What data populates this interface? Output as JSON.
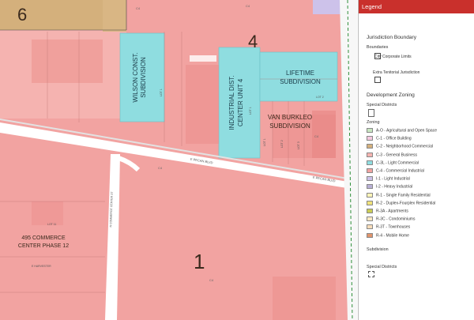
{
  "map": {
    "district_labels": [
      "6",
      "4",
      "1"
    ],
    "subdivisions": [
      "WILSON CONST. SUBDIVISION",
      "INDUSTRIAL DIST. CENTER UNIT 4",
      "LIFETIME SUBDIVISION",
      "VAN BURKLEO SUBDIVISION",
      "495 COMMERCE CENTER PHASE 12"
    ],
    "subdivision_lines": {
      "wilson": [
        "WILSON CONST.",
        "SUBDIVISION"
      ],
      "industrial": [
        "INDUSTRIAL DIST.",
        "CENTER UNIT 4"
      ],
      "lifetime": [
        "LIFETIME",
        "SUBDIVISION"
      ],
      "vanburkleo": [
        "VAN BURKLEO",
        "SUBDIVISION"
      ],
      "commerce": [
        "495 COMMERCE",
        "CENTER PHASE 12"
      ]
    },
    "street_labels": [
      "E PECAN BLVD",
      "E PECAN BLVD",
      "N COMMERCE CENTER ST",
      "E HARVESTER"
    ],
    "lot_labels": [
      "LOT 1",
      "LOT 1",
      "LOT 2",
      "LOT 1",
      "LOT 2",
      "LOT 3",
      "LOT 11"
    ],
    "zone_labels": [
      "C4",
      "C4",
      "C4",
      "C4",
      "C4"
    ],
    "zone_colors": {
      "c4": "#f2a3a1",
      "c3": "#8fdde0",
      "c2": "#d4b07c",
      "i1": "#cdc2ea"
    }
  },
  "legend": {
    "header": "Legend",
    "jurisdiction_title": "Jurisdiction Boundary",
    "boundaries_title": "Boundaries",
    "city_limits": "City Corporate Limits",
    "etj": "Extra Tenitorial Jurisdiction",
    "zoning_title": "Development Zoning",
    "special_districts_1": "Special Districts",
    "zoning_subtitle": "Zoning",
    "zoning_items": [
      {
        "label": "A-O - Agricultural and Open Space",
        "color": "#c8e6c0"
      },
      {
        "label": "C-1 - Office Building",
        "color": "#f4c9df"
      },
      {
        "label": "C-2 - Neighborhood Commercial",
        "color": "#d4b07c"
      },
      {
        "label": "C-3 - General Business",
        "color": "#f5b3b0"
      },
      {
        "label": "C-3L - Light Commercial",
        "color": "#8fdde0"
      },
      {
        "label": "C-4 - Commercial Industrial",
        "color": "#f2a3a1"
      },
      {
        "label": "I-1 - Light Industrial",
        "color": "#cdc2ea"
      },
      {
        "label": "I-2 - Heavy Industrial",
        "color": "#b9b0d6"
      },
      {
        "label": "R-1 - Single Family Residential",
        "color": "#fff5b8"
      },
      {
        "label": "R-2 - Duplex-Fourplex Residential",
        "color": "#f0e27a"
      },
      {
        "label": "R-3A - Apartments",
        "color": "#c9cc55"
      },
      {
        "label": "R-3C - Condominiums",
        "color": "#fbe9c4"
      },
      {
        "label": "R-3T - Townhouses",
        "color": "#f8ddbb"
      },
      {
        "label": "R-4 - Mobile Home",
        "color": "#e0946c"
      }
    ],
    "subdivision_title": "Subdivision",
    "special_districts_2": "Special Districts"
  }
}
